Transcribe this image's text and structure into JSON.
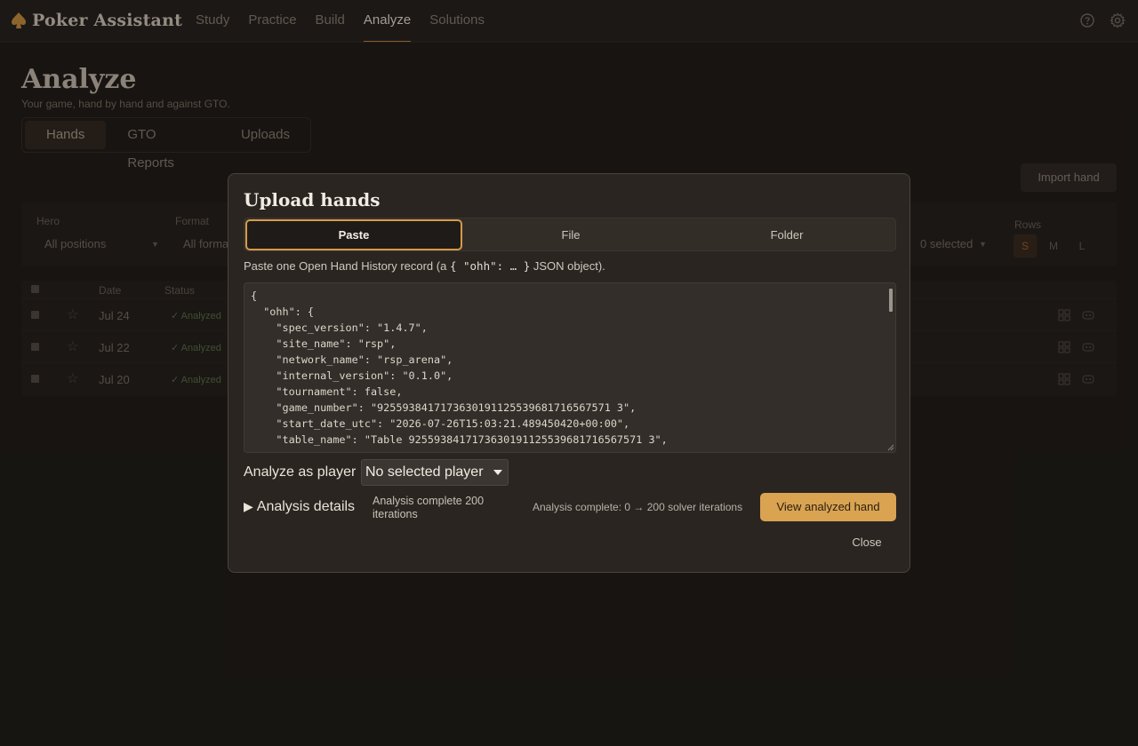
{
  "nav": {
    "brand": "Poker Assistant",
    "links": [
      "Study",
      "Practice",
      "Build",
      "Analyze",
      "Solutions"
    ],
    "active": "Analyze",
    "icons": [
      "help-icon",
      "gear-icon"
    ]
  },
  "page": {
    "title": "Analyze",
    "subtitle": "Your game, hand by hand and against GTO.",
    "tabs": [
      "Hands",
      "GTO Reports",
      "Uploads"
    ],
    "active_tab": "Hands",
    "import_label": "Import hand"
  },
  "filters": {
    "hero_label": "Hero",
    "hero_value": "All positions",
    "format_label": "Format",
    "format_value": "All forma",
    "selected_value": "0 selected",
    "rows_label": "Rows",
    "rows_options": [
      "S",
      "M",
      "L"
    ],
    "rows_active": "S"
  },
  "table": {
    "headers": [
      "Date",
      "Status"
    ],
    "rows": [
      {
        "date": "Jul 24",
        "status": "✓ Analyzed"
      },
      {
        "date": "Jul 22",
        "status": "✓ Analyzed"
      },
      {
        "date": "Jul 20",
        "status": "✓ Analyzed"
      }
    ]
  },
  "modal": {
    "title": "Upload hands",
    "segments": [
      "Paste",
      "File",
      "Folder"
    ],
    "active_segment": "Paste",
    "hint_before": "Paste one Open Hand History record (a ",
    "hint_code": "{ \"ohh\": … }",
    "hint_after": " JSON object).",
    "json_text": "{\n  \"ohh\": {\n    \"spec_version\": \"1.4.7\",\n    \"site_name\": \"rsp\",\n    \"network_name\": \"rsp_arena\",\n    \"internal_version\": \"0.1.0\",\n    \"tournament\": false,\n    \"game_number\": \"9255938417173630191125539681716567571 3\",\n    \"start_date_utc\": \"2026-07-26T15:03:21.489450420+00:00\",\n    \"table_name\": \"Table 9255938417173630191125539681716567571 3\",",
    "player_label": "Analyze as player",
    "player_value": "No selected player",
    "details_label": "Analysis details",
    "complete_text": "Analysis complete 200 iterations",
    "complete_status": "Analysis complete: 0 → 200 solver iterations",
    "view_label": "View analyzed hand",
    "close_label": "Close"
  },
  "colors": {
    "accent": "#d9a352",
    "background": "#1c1915",
    "modal": "#2a2521"
  }
}
